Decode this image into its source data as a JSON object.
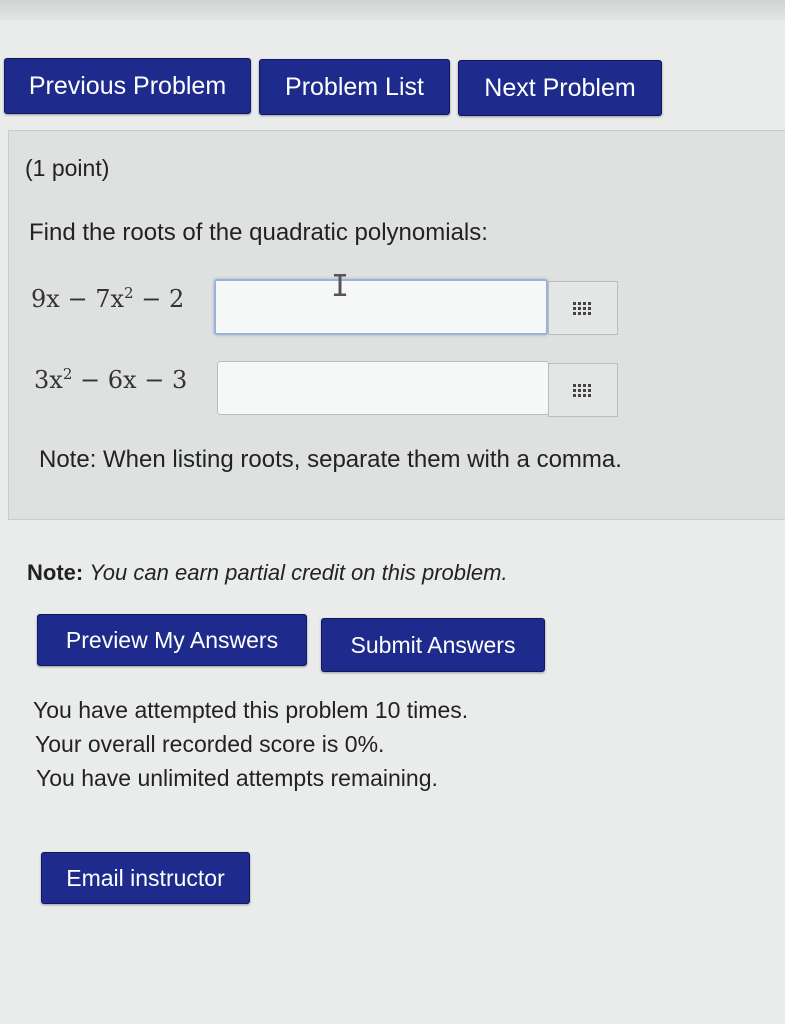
{
  "nav": {
    "previous": "Previous Problem",
    "list": "Problem List",
    "next": "Next Problem"
  },
  "problem": {
    "points": "(1 point)",
    "prompt": "Find the roots of the quadratic polynomials:",
    "eq1": {
      "a": "9x",
      "b": "7x",
      "exp": "2",
      "c": "2",
      "value": ""
    },
    "eq2": {
      "a": "3x",
      "exp": "2",
      "b": "6x",
      "c": "3",
      "value": ""
    },
    "minus": "−",
    "note": "Note: When listing roots, separate them with a comma."
  },
  "partial": {
    "label": "Note:",
    "text": "You can earn partial credit on this problem."
  },
  "actions": {
    "preview": "Preview My Answers",
    "submit": "Submit Answers"
  },
  "status": {
    "attempted": "You have attempted this problem 10 times.",
    "score": "Your overall recorded score is 0%.",
    "remaining": "You have unlimited attempts remaining."
  },
  "email": "Email instructor",
  "colors": {
    "button": "#1e2b8c",
    "panel": "#dfe1e0"
  }
}
